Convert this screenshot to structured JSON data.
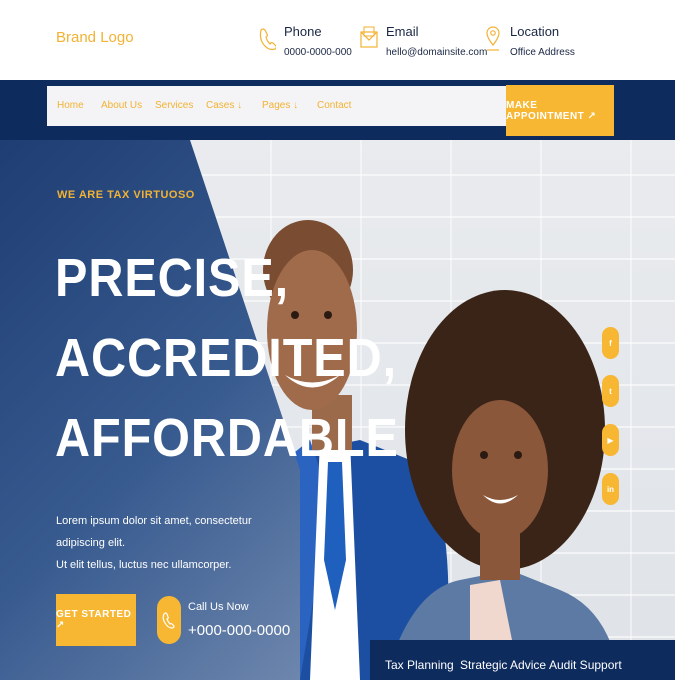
{
  "brand": {
    "logo": "Brand Logo"
  },
  "contacts": {
    "phone": {
      "label": "Phone",
      "value": "0000-0000-000",
      "icon": "phone-icon"
    },
    "email": {
      "label": "Email",
      "value": "hello@domainsite.com",
      "icon": "envelope-icon"
    },
    "location": {
      "label": "Location",
      "value": "Office Address",
      "icon": "map-pin-icon"
    }
  },
  "nav": {
    "items": [
      "Home",
      "About Us",
      "Services",
      "Cases ↓",
      "Pages ↓",
      "Contact"
    ],
    "cta": "MAKE APPOINTMENT ↗"
  },
  "hero": {
    "tagline": "WE ARE TAX VIRTUOSO",
    "headline": [
      "PRECISE,",
      "ACCREDITED,",
      "AFFORDABLE"
    ],
    "description": [
      "Lorem ipsum dolor sit amet, consectetur adipiscing elit.",
      "Ut elit tellus, luctus nec ullamcorper."
    ],
    "cta": "GET STARTED ↗",
    "call_label": "Call Us Now",
    "call_number": "+000-000-0000"
  },
  "social": [
    "facebook-icon",
    "twitter-icon",
    "youtube-icon",
    "linkedin-icon"
  ],
  "services": [
    "Tax Planning",
    "Strategic Advice",
    "Audit Support"
  ],
  "colors": {
    "accent": "#f7b733",
    "navy": "#0e2b5e",
    "text": "#1a2744"
  }
}
